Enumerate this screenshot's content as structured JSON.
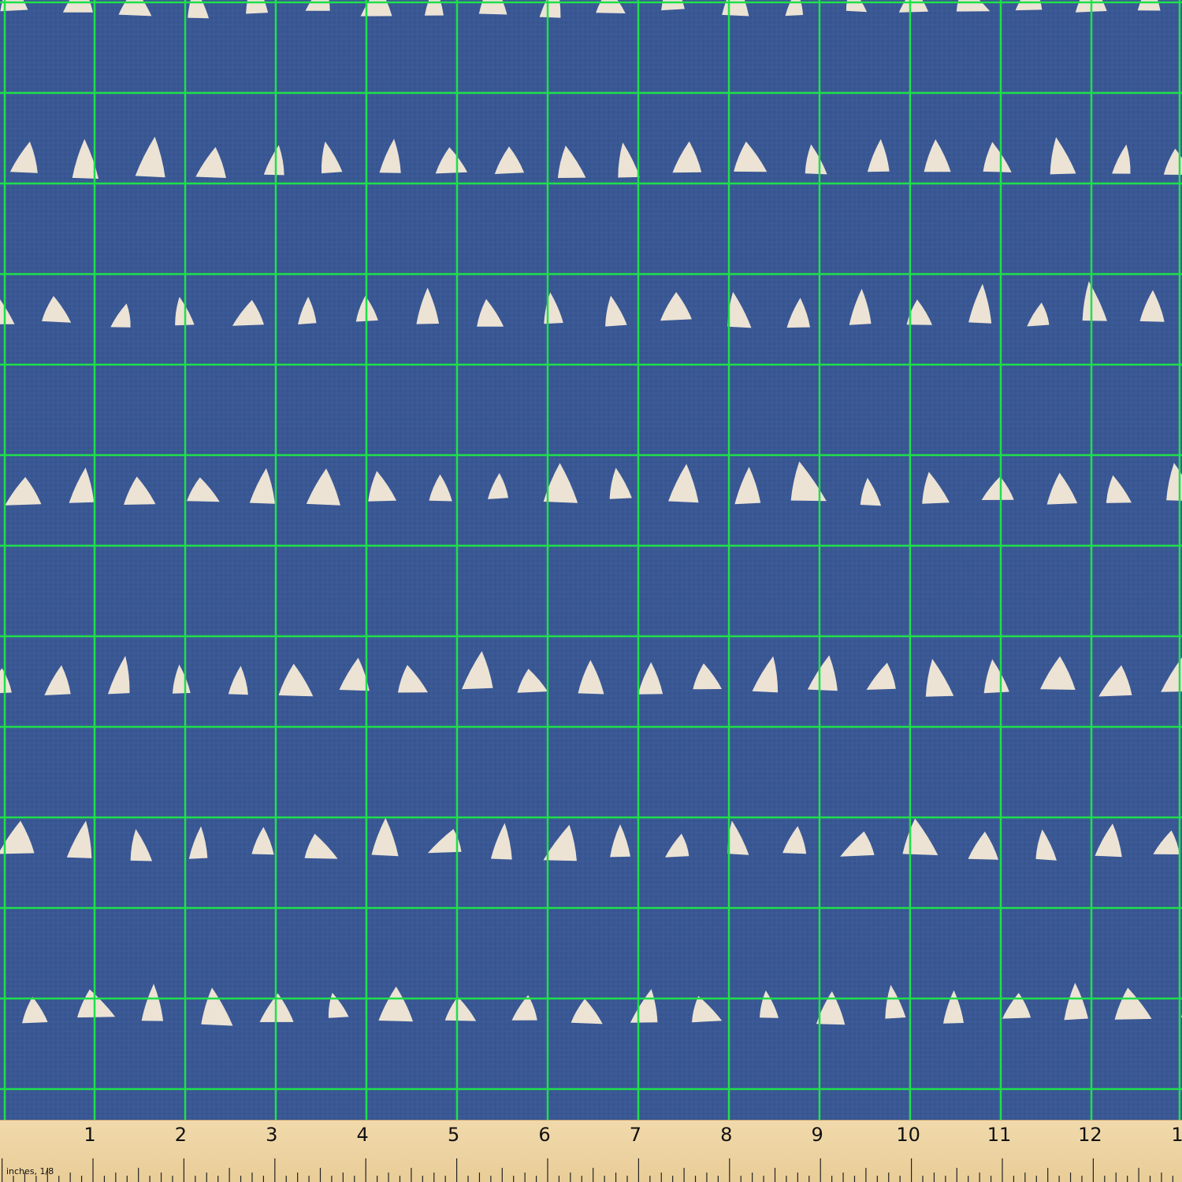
{
  "image": {
    "description_type": "fabric swatch",
    "background_color": "#3a5894",
    "shape_color": "#ece3d4",
    "grid_color": "#1ee04a",
    "motif": "hand-drawn-triangle-rows"
  },
  "ruler": {
    "unit_label": "inches, 1/8",
    "numbers": [
      "1",
      "2",
      "3",
      "4",
      "5",
      "6",
      "7",
      "8",
      "9",
      "10",
      "11",
      "12",
      "1"
    ]
  }
}
